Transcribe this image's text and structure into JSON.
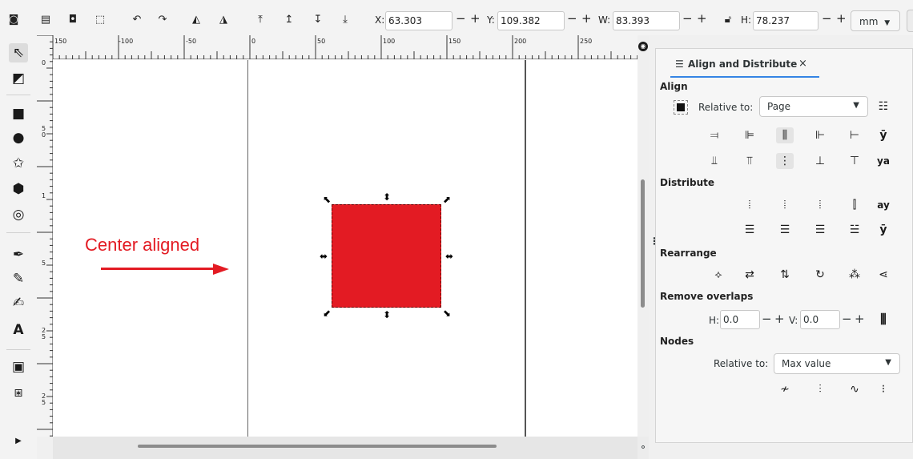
{
  "toolbar": {
    "x_label": "X:",
    "x_value": "63.303",
    "y_label": "Y:",
    "y_value": "109.382",
    "w_label": "W:",
    "w_value": "83.393",
    "h_label": "H:",
    "h_value": "78.237",
    "minus": "−",
    "plus": "+",
    "units": "mm"
  },
  "ruler": {
    "top_ticks": [
      "150",
      "-100",
      "-50",
      "0",
      "50",
      "100",
      "150",
      "200",
      "250"
    ],
    "left_ticks": [
      "0",
      "5",
      "0",
      "1",
      "5",
      "2",
      "5",
      "2",
      "5"
    ]
  },
  "canvas": {
    "annotation": "Center aligned",
    "object_color": "#e31b23",
    "annotation_color": "#e31b23"
  },
  "panel": {
    "tab_title": "Align and Distribute",
    "tab_close": "×",
    "align_title": "Align",
    "relative_to_label": "Relative to:",
    "relative_to_value": "Page",
    "distribute_title": "Distribute",
    "rearrange_title": "Rearrange",
    "remove_overlaps_title": "Remove overlaps",
    "h_label": "H:",
    "h_value": "0.0",
    "v_label": "V:",
    "v_value": "0.0",
    "nodes_title": "Nodes",
    "nodes_relative_label": "Relative to:",
    "nodes_relative_value": "Max value"
  }
}
